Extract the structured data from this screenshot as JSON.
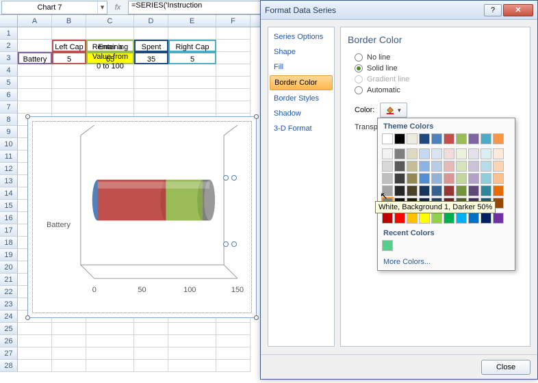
{
  "namebox": "Chart 7",
  "fx_label": "fx",
  "formula": "=SERIES('Instruction",
  "columns": [
    "A",
    "B",
    "C",
    "D",
    "E",
    "F"
  ],
  "row_numbers": [
    "1",
    "2",
    "3",
    "4",
    "5",
    "6",
    "7",
    "8",
    "9",
    "10",
    "11",
    "12",
    "13",
    "14",
    "15",
    "16",
    "17",
    "18",
    "19",
    "20",
    "21",
    "22",
    "23",
    "24",
    "25",
    "26",
    "27",
    "28"
  ],
  "instruction_text": "Enter a\nValue from\n0 to 100",
  "headers": {
    "a": "",
    "b": "Left Cap",
    "c": "Remaining",
    "d": "Spent",
    "e": "Right Cap"
  },
  "data": {
    "a": "Battery",
    "b": "5",
    "c": "65",
    "d": "35",
    "e": "5"
  },
  "chart": {
    "series_label": "Battery",
    "x_ticks": [
      "0",
      "50",
      "100",
      "150"
    ]
  },
  "dialog": {
    "title": "Format Data Series",
    "help_icon": "?",
    "close_icon": "✕",
    "side_items": [
      "Series Options",
      "Shape",
      "Fill",
      "Border Color",
      "Border Styles",
      "Shadow",
      "3-D Format"
    ],
    "active_side": "Border Color",
    "panel_title": "Border Color",
    "radios": {
      "noline": "No line",
      "solid": "Solid line",
      "gradient": "Gradient line",
      "automatic": "Automatic"
    },
    "color_label": "Color:",
    "transparency_label": "Transpa",
    "close_btn": "Close"
  },
  "popup": {
    "header1": "Theme Colors",
    "header2": "Recent Colors",
    "more": "More Colors...",
    "tooltip": "White, Background 1, Darker 50%",
    "theme_row1": [
      "#ffffff",
      "#000000",
      "#eeece1",
      "#1f497d",
      "#4f81bd",
      "#c0504d",
      "#9bbb59",
      "#8064a2",
      "#4bacc6",
      "#f79646"
    ],
    "shade_rows": [
      [
        "#f2f2f2",
        "#7f7f7f",
        "#ddd9c3",
        "#c6d9f0",
        "#dbe5f1",
        "#f2dcdb",
        "#ebf1dd",
        "#e5e0ec",
        "#dbeef3",
        "#fdeada"
      ],
      [
        "#d8d8d8",
        "#595959",
        "#c4bd97",
        "#8db3e2",
        "#b8cce4",
        "#e5b9b7",
        "#d7e3bc",
        "#ccc1d9",
        "#b7dde8",
        "#fbd5b5"
      ],
      [
        "#bfbfbf",
        "#3f3f3f",
        "#938953",
        "#548dd4",
        "#95b3d7",
        "#d99694",
        "#c3d69b",
        "#b2a2c7",
        "#92cddc",
        "#fac08f"
      ],
      [
        "#a5a5a5",
        "#262626",
        "#494429",
        "#17365d",
        "#366092",
        "#953734",
        "#76923c",
        "#5f497a",
        "#31859b",
        "#e36c09"
      ],
      [
        "#7f7f7f",
        "#0c0c0c",
        "#1d1b10",
        "#0f243e",
        "#244061",
        "#632423",
        "#4f6128",
        "#3f3151",
        "#205867",
        "#974806"
      ]
    ],
    "standard_row": [
      "#c00000",
      "#ff0000",
      "#ffc000",
      "#ffff00",
      "#92d050",
      "#00b050",
      "#00b0f0",
      "#0070c0",
      "#002060",
      "#7030a0"
    ],
    "recent": [
      "#5bcd8b"
    ]
  },
  "chart_data": {
    "type": "bar",
    "orientation": "horizontal-stacked",
    "categories": [
      "Battery"
    ],
    "series": [
      {
        "name": "Left Cap",
        "values": [
          5
        ],
        "color": "#4f81bd"
      },
      {
        "name": "Remaining",
        "values": [
          65
        ],
        "color": "#c0504d"
      },
      {
        "name": "Spent",
        "values": [
          35
        ],
        "color": "#9bbb59"
      },
      {
        "name": "Right Cap",
        "values": [
          5
        ],
        "color": "#808080"
      }
    ],
    "xlabel": "",
    "ylabel": "",
    "xlim": [
      0,
      150
    ],
    "x_ticks": [
      0,
      50,
      100,
      150
    ],
    "title": ""
  }
}
